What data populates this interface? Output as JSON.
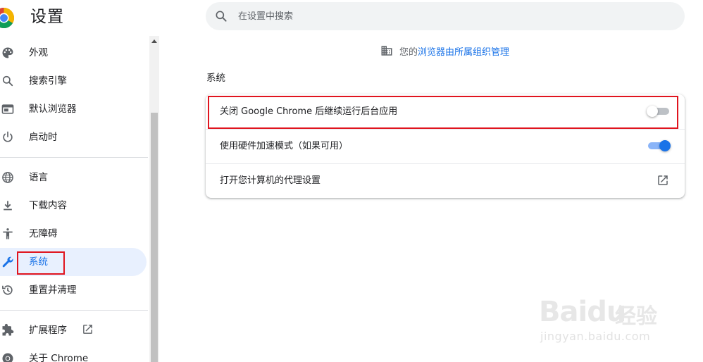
{
  "app": {
    "title": "设置"
  },
  "search": {
    "placeholder": "在设置中搜索"
  },
  "sidebar": {
    "items": [
      {
        "label": "外观",
        "icon": "palette-icon"
      },
      {
        "label": "搜索引擎",
        "icon": "search-icon"
      },
      {
        "label": "默认浏览器",
        "icon": "browser-window-icon"
      },
      {
        "label": "启动时",
        "icon": "power-icon"
      },
      {
        "label": "语言",
        "icon": "globe-icon"
      },
      {
        "label": "下载内容",
        "icon": "download-icon"
      },
      {
        "label": "无障碍",
        "icon": "accessibility-icon"
      },
      {
        "label": "系统",
        "icon": "wrench-icon",
        "active": true
      },
      {
        "label": "重置并清理",
        "icon": "history-reset-icon"
      },
      {
        "label": "扩展程序",
        "icon": "puzzle-icon"
      },
      {
        "label": "关于 Chrome",
        "icon": "chrome-icon"
      }
    ]
  },
  "managed": {
    "prefix": "您的",
    "link": "浏览器由所属组织管理"
  },
  "section": {
    "title": "系统",
    "rows": [
      {
        "label": "关闭 Google Chrome 后继续运行后台应用",
        "control": "toggle",
        "checked": false
      },
      {
        "label": "使用硬件加速模式（如果可用）",
        "control": "toggle",
        "checked": true
      },
      {
        "label": "打开您计算机的代理设置",
        "control": "external-link"
      }
    ]
  },
  "watermark": {
    "brand": "Baidu",
    "suffix": "经验",
    "url": "jingyan.baidu.com"
  },
  "colors": {
    "accent": "#1a73e8",
    "active_bg": "#e8f0fe",
    "annotation_red": "#e0141e"
  }
}
